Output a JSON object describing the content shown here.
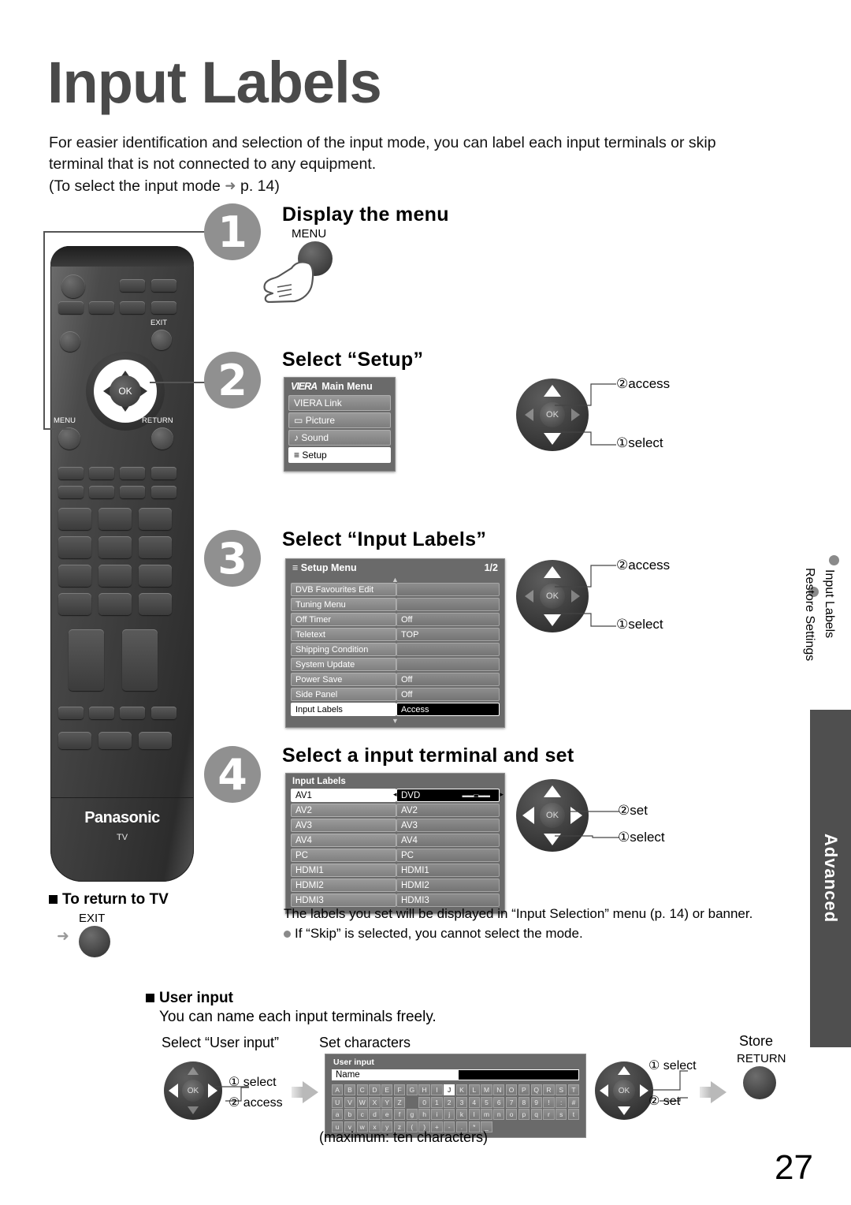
{
  "page": {
    "title": "Input Labels",
    "intro_line1": "For easier identification and selection of the input mode, you can label each input terminals or skip",
    "intro_line2": "terminal that is not connected to any equipment.",
    "intro_line3_pre": "(To select the input mode",
    "intro_line3_post": "p. 14)",
    "page_number": "27"
  },
  "steps": {
    "one": {
      "num": "1",
      "heading": "Display the menu",
      "button_label": "MENU"
    },
    "two": {
      "num": "2",
      "heading": "Select “Setup”",
      "nav_note_1": "②access",
      "nav_note_2": "①select"
    },
    "three": {
      "num": "3",
      "heading": "Select “Input Labels”",
      "nav_note_1": "②access",
      "nav_note_2": "①select"
    },
    "four": {
      "num": "4",
      "heading": "Select a input terminal and set",
      "nav_note_1": "②set",
      "nav_note_2": "①select"
    }
  },
  "main_menu": {
    "logo": "VIERA",
    "title": "Main Menu",
    "items": [
      {
        "icon": "",
        "label": "VIERA Link",
        "selected": false
      },
      {
        "icon": "▭",
        "label": "Picture",
        "selected": false
      },
      {
        "icon": "♪",
        "label": "Sound",
        "selected": false
      },
      {
        "icon": "≡",
        "label": "Setup",
        "selected": true
      }
    ]
  },
  "setup_menu": {
    "icon": "list-icon",
    "title": "Setup Menu",
    "page_indicator": "1/2",
    "scroll_up": "▲",
    "scroll_down": "▼",
    "rows": [
      {
        "label": "DVB Favourites Edit",
        "value": "",
        "selected": false
      },
      {
        "label": "Tuning Menu",
        "value": "",
        "selected": false
      },
      {
        "label": "Off Timer",
        "value": "Off",
        "selected": false
      },
      {
        "label": "Teletext",
        "value": "TOP",
        "selected": false
      },
      {
        "label": "Shipping Condition",
        "value": "",
        "selected": false
      },
      {
        "label": "System Update",
        "value": "",
        "selected": false
      },
      {
        "label": "Power Save",
        "value": "Off",
        "selected": false
      },
      {
        "label": "Side Panel",
        "value": "Off",
        "selected": false
      },
      {
        "label": "Input Labels",
        "value": "Access",
        "selected": true
      }
    ]
  },
  "input_labels_menu": {
    "title": "Input Labels",
    "rows": [
      {
        "terminal": "AV1",
        "label": "DVD",
        "selected": true
      },
      {
        "terminal": "AV2",
        "label": "AV2",
        "selected": false
      },
      {
        "terminal": "AV3",
        "label": "AV3",
        "selected": false
      },
      {
        "terminal": "AV4",
        "label": "AV4",
        "selected": false
      },
      {
        "terminal": "PC",
        "label": "PC",
        "selected": false
      },
      {
        "terminal": "HDMI1",
        "label": "HDMI1",
        "selected": false
      },
      {
        "terminal": "HDMI2",
        "label": "HDMI2",
        "selected": false
      },
      {
        "terminal": "HDMI3",
        "label": "HDMI3",
        "selected": false
      }
    ]
  },
  "return_to_tv": {
    "heading": "To return to TV",
    "button_label": "EXIT"
  },
  "notes": {
    "line1": "The labels you set will be displayed in “Input Selection” menu (p. 14) or banner.",
    "line2": "If “Skip” is selected, you cannot select the mode."
  },
  "user_input": {
    "heading": "User input",
    "sub": "You can name each input terminals freely.",
    "col1_label": "Select “User input”",
    "col1_note1": "① select",
    "col1_note2": "② access",
    "col2_label": "Set characters",
    "col3_note1": "① select",
    "col3_note2": "② set",
    "store_label": "Store",
    "store_button": "RETURN",
    "max_chars": "(maximum: ten characters)",
    "osd": {
      "title": "User input",
      "name_label": "Name",
      "name_value": "",
      "selected_key": "J",
      "rows": [
        [
          "A",
          "B",
          "C",
          "D",
          "E",
          "F",
          "G",
          "H",
          "I",
          "J",
          "K",
          "L",
          "M",
          "N",
          "O",
          "P",
          "Q",
          "R",
          "S",
          "T"
        ],
        [
          "U",
          "V",
          "W",
          "X",
          "Y",
          "Z",
          "",
          "0",
          "1",
          "2",
          "3",
          "4",
          "5",
          "6",
          "7",
          "8",
          "9",
          "!",
          ":",
          "#"
        ],
        [
          "a",
          "b",
          "c",
          "d",
          "e",
          "f",
          "g",
          "h",
          "i",
          "j",
          "k",
          "l",
          "m",
          "n",
          "o",
          "p",
          "q",
          "r",
          "s",
          "t"
        ],
        [
          "u",
          "v",
          "w",
          "x",
          "y",
          "z",
          "(",
          ")",
          "+",
          "-",
          ".",
          "*",
          "_",
          "",
          "",
          "",
          "",
          "",
          "",
          ""
        ]
      ]
    }
  },
  "remote": {
    "brand": "Panasonic",
    "brand_sub": "TV",
    "labels": {
      "exit": "EXIT",
      "menu": "MENU",
      "return": "RETURN",
      "ok": "OK"
    }
  },
  "sidebar": {
    "toc": [
      "Input Labels",
      "Restore Settings"
    ],
    "tab_label": "Advanced"
  },
  "colors": {
    "title_gray": "#4a4a4a",
    "step_circle": "#909090",
    "osd_bg": "#6a6a6a",
    "tab_bg": "#4f4f4f"
  }
}
